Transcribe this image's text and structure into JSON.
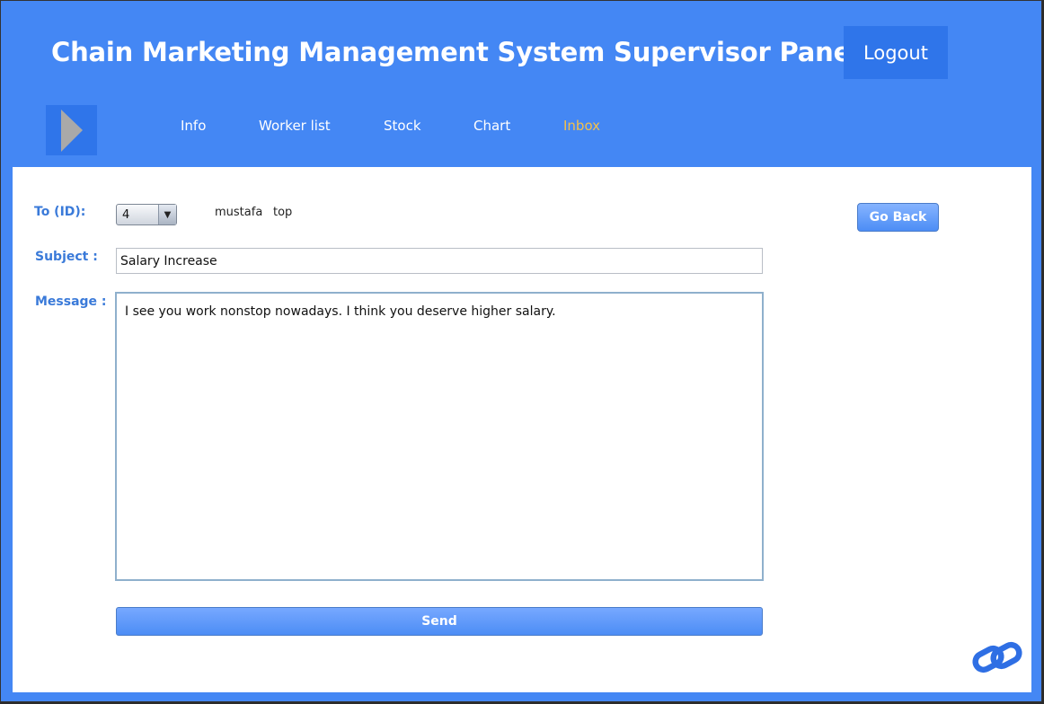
{
  "header": {
    "title": "Chain Marketing Management System Supervisor Panel",
    "logout_label": "Logout",
    "toggle_icon": "play-triangle-icon"
  },
  "nav": {
    "items": [
      {
        "label": "Info",
        "active": false
      },
      {
        "label": "Worker list",
        "active": false
      },
      {
        "label": "Stock",
        "active": false
      },
      {
        "label": "Chart",
        "active": false
      },
      {
        "label": "Inbox",
        "active": true
      }
    ]
  },
  "form": {
    "to_label": "To (ID):",
    "to_value": "4",
    "recipient_first_name": "mustafa",
    "recipient_last_name": "top",
    "subject_label": "Subject :",
    "subject_value": "Salary Increase",
    "message_label": "Message :",
    "message_value": "I see you work nonstop nowadays. I think you deserve higher salary.",
    "send_label": "Send",
    "go_back_label": "Go Back"
  },
  "footer": {
    "link_icon": "chain-link-icon"
  },
  "colors": {
    "header_bg": "#4487f4",
    "accent_dark": "#2f75ea",
    "active_nav": "#f3c04a",
    "label_blue": "#3a7ad9"
  }
}
